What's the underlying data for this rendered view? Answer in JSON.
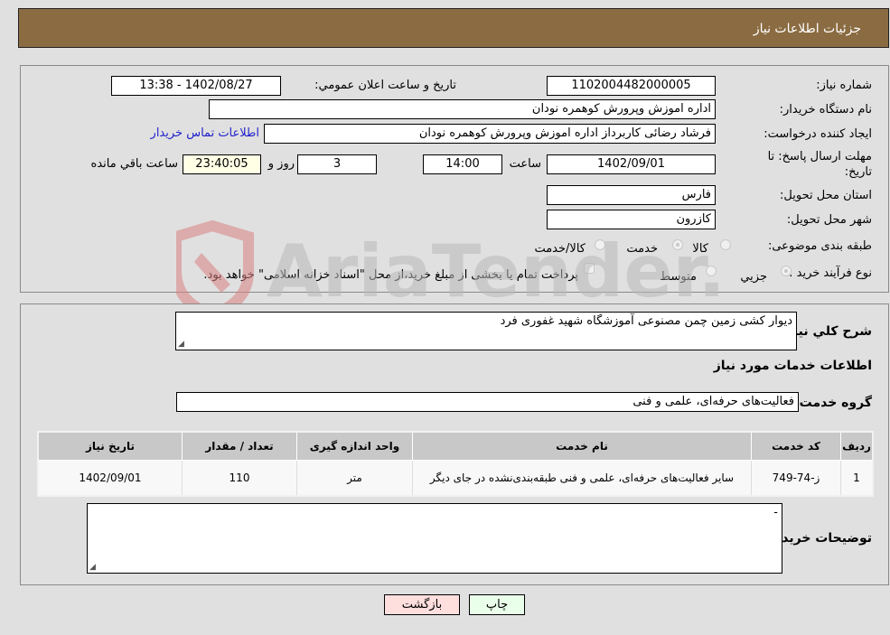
{
  "header": {
    "title": "جزئیات اطلاعات نیاز"
  },
  "form": {
    "need_number": {
      "label": "شماره نیاز:",
      "value": "1102004482000005"
    },
    "announce_datetime": {
      "label": "تاریخ و ساعت اعلان عمومي:",
      "value": "1402/08/27 - 13:38"
    },
    "buyer_org": {
      "label": "نام دستگاه خریدار:",
      "value": "اداره اموزش وپرورش کوهمره نودان"
    },
    "requester": {
      "label": "ایجاد کننده درخواست:",
      "value": "فرشاد رضائی کاربرداز اداره اموزش وپرورش کوهمره نودان"
    },
    "buyer_contact_link": "اطلاعات تماس خریدار",
    "deadline": {
      "label": "مهلت ارسال پاسخ: تا تاریخ:",
      "date": "1402/09/01",
      "time_label": "ساعت",
      "time": "14:00",
      "days": "3",
      "days_label": "روز و",
      "remaining": "23:40:05",
      "remaining_label": "ساعت باقي مانده"
    },
    "province": {
      "label": "استان محل تحویل:",
      "value": "فارس"
    },
    "city": {
      "label": "شهر محل تحویل:",
      "value": "کازرون"
    },
    "category": {
      "label": "طبقه بندی موضوعی:",
      "options": [
        "کالا",
        "خدمت",
        "کالا/خدمت"
      ],
      "selected": "خدمت"
    },
    "purchase_type": {
      "label": "نوع فرآیند خرید :",
      "options": [
        "جزيي",
        "متوسط"
      ],
      "selected": "جزيي",
      "treasury_note": "پرداخت تمام یا بخشی از مبلغ خرید،از محل \"اسناد خزانه اسلامی\" خواهد بود."
    }
  },
  "description": {
    "label": "شرح کلي نیاز:",
    "value": "دیوار کشی زمین چمن مصنوعی آموزشگاه شهید غفوری فرد"
  },
  "services": {
    "section_title": "اطلاعات خدمات مورد نیاز",
    "group_label": "گروه خدمت:",
    "group_value": "فعالیت‌های حرفه‌ای، علمی و فنی",
    "table": {
      "headers": [
        "ردیف",
        "کد خدمت",
        "نام خدمت",
        "واحد اندازه گیری",
        "تعداد / مقدار",
        "تاریخ نیاز"
      ],
      "rows": [
        [
          "1",
          "ز-74-749",
          "سایر فعالیت‌های حرفه‌ای، علمی و فنی طبقه‌بندی‌نشده در جای دیگر",
          "متر",
          "110",
          "1402/09/01"
        ]
      ]
    }
  },
  "buyer_notes": {
    "label": "توضیحات خریدار:",
    "value": "-"
  },
  "buttons": {
    "print": "چاپ",
    "back": "بازگشت"
  },
  "watermark": "AriaTender.neT",
  "colors": {
    "header_bg": "#8b6c42",
    "print_bg": "#eaffea",
    "back_bg": "#ffdede",
    "link": "#2222cc"
  }
}
